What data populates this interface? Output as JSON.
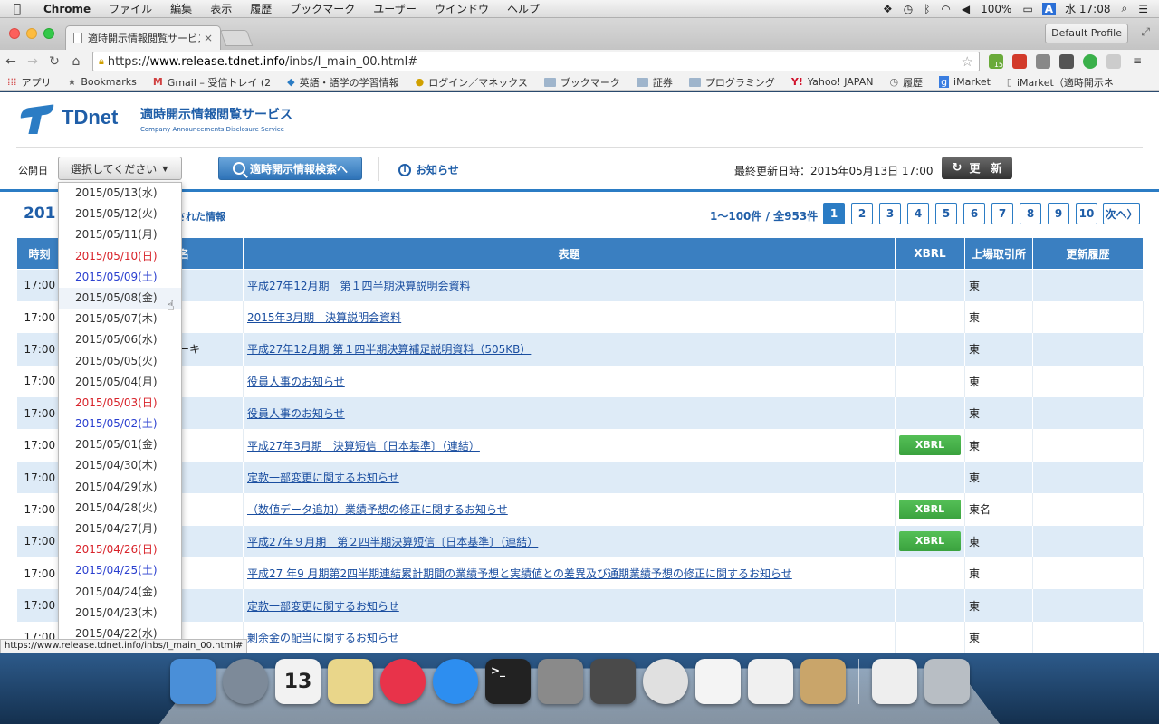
{
  "menubar": {
    "app": "Chrome",
    "items": [
      "ファイル",
      "編集",
      "表示",
      "履歴",
      "ブックマーク",
      "ユーザー",
      "ウインドウ",
      "ヘルプ"
    ],
    "battery": "100%",
    "input_source": "A",
    "clock": "水 17:08"
  },
  "browser": {
    "tab_title": "適時開示情報閲覧サービス –",
    "profile": "Default Profile",
    "url_scheme": "https://",
    "url_host": "www.release.tdnet.info",
    "url_path": "/inbs/I_main_00.html#",
    "ext_badge": "15",
    "bookmarks": [
      "アプリ",
      "Bookmarks",
      "Gmail – 受信トレイ (2",
      "英語・語学の学習情報",
      "ログイン／マネックス",
      "ブックマーク",
      "証券",
      "プログラミング",
      "Yahoo! JAPAN",
      "履歴",
      "iMarket",
      "iMarket（適時開示ネ"
    ],
    "status_url": "https://www.release.tdnet.info/inbs/I_main_00.html#"
  },
  "site": {
    "logo": "TDnet",
    "title_jp": "適時開示情報閲覧サービス",
    "title_en": "Company Announcements Disclosure Service"
  },
  "controls": {
    "date_label": "公開日",
    "select_label": "選択してください",
    "search_label": "適時開示情報検索へ",
    "notice_label": "お知らせ",
    "updated_label": "最終更新日時：2015年05月13日 17:00",
    "refresh_label": "更　新"
  },
  "listhead": {
    "date_title": "201",
    "subtitle": "示された情報",
    "count": "1〜100件 / 全953件",
    "pages": [
      "1",
      "2",
      "3",
      "4",
      "5",
      "6",
      "7",
      "8",
      "9",
      "10"
    ],
    "next": "次へ"
  },
  "table": {
    "headers": {
      "time": "時刻",
      "name": "名",
      "title": "表題",
      "xbrl": "XBRL",
      "exchange": "上場取引所",
      "history": "更新履歴"
    },
    "rows": [
      {
        "time": "17:00",
        "name": "",
        "title": "平成27年12月期　第１四半期決算説明会資料",
        "xbrl": "",
        "exchange": "東"
      },
      {
        "time": "17:00",
        "name": "",
        "title": "2015年3月期　決算説明会資料",
        "xbrl": "",
        "exchange": "東"
      },
      {
        "time": "17:00",
        "name": "ーキ",
        "title": "平成27年12月期 第１四半期決算補足説明資料（505KB）",
        "xbrl": "",
        "exchange": "東"
      },
      {
        "time": "17:00",
        "name": "",
        "title": "役員人事のお知らせ",
        "xbrl": "",
        "exchange": "東"
      },
      {
        "time": "17:00",
        "name": "",
        "title": "役員人事のお知らせ",
        "xbrl": "",
        "exchange": "東"
      },
      {
        "time": "17:00",
        "name": "",
        "title": "平成27年3月期　決算短信〔日本基準〕（連結）",
        "xbrl": "XBRL",
        "exchange": "東"
      },
      {
        "time": "17:00",
        "name": "",
        "title": "定款一部変更に関するお知らせ",
        "xbrl": "",
        "exchange": "東"
      },
      {
        "time": "17:00",
        "name": "",
        "title": "（数値データ追加）業績予想の修正に関するお知らせ",
        "xbrl": "XBRL",
        "exchange": "東名"
      },
      {
        "time": "17:00",
        "name": "",
        "title": "平成27年９月期　第２四半期決算短信〔日本基準〕（連結）",
        "xbrl": "XBRL",
        "exchange": "東"
      },
      {
        "time": "17:00",
        "name": "",
        "title": "平成27 年9 月期第2四半期連結累計期間の業績予想と実績値との差異及び通期業績予想の修正に関するお知らせ",
        "xbrl": "",
        "exchange": "東"
      },
      {
        "time": "17:00",
        "name": "",
        "title": "定款一部変更に関するお知らせ",
        "xbrl": "",
        "exchange": "東"
      },
      {
        "time": "17:00",
        "name": "",
        "title": "剰余金の配当に関するお知らせ",
        "xbrl": "",
        "exchange": "東"
      }
    ]
  },
  "dropdown": {
    "options": [
      {
        "label": "2015/05/13(水)",
        "kind": "weekday"
      },
      {
        "label": "2015/05/12(火)",
        "kind": "weekday"
      },
      {
        "label": "2015/05/11(月)",
        "kind": "weekday"
      },
      {
        "label": "2015/05/10(日)",
        "kind": "sunday"
      },
      {
        "label": "2015/05/09(土)",
        "kind": "saturday"
      },
      {
        "label": "2015/05/08(金)",
        "kind": "hover"
      },
      {
        "label": "2015/05/07(木)",
        "kind": "weekday"
      },
      {
        "label": "2015/05/06(水)",
        "kind": "weekday"
      },
      {
        "label": "2015/05/05(火)",
        "kind": "weekday"
      },
      {
        "label": "2015/05/04(月)",
        "kind": "weekday"
      },
      {
        "label": "2015/05/03(日)",
        "kind": "sunday"
      },
      {
        "label": "2015/05/02(土)",
        "kind": "saturday"
      },
      {
        "label": "2015/05/01(金)",
        "kind": "weekday"
      },
      {
        "label": "2015/04/30(木)",
        "kind": "weekday"
      },
      {
        "label": "2015/04/29(水)",
        "kind": "weekday"
      },
      {
        "label": "2015/04/28(火)",
        "kind": "weekday"
      },
      {
        "label": "2015/04/27(月)",
        "kind": "weekday"
      },
      {
        "label": "2015/04/26(日)",
        "kind": "sunday"
      },
      {
        "label": "2015/04/25(土)",
        "kind": "saturday"
      },
      {
        "label": "2015/04/24(金)",
        "kind": "weekday"
      },
      {
        "label": "2015/04/23(木)",
        "kind": "weekday"
      },
      {
        "label": "2015/04/22(水)",
        "kind": "weekday"
      }
    ]
  },
  "dock": {
    "calendar_day": "13",
    "terminal_prompt": ">_",
    "apps": [
      {
        "name": "finder",
        "color": "#4a8fd8"
      },
      {
        "name": "launchpad",
        "color": "#7d8a99"
      },
      {
        "name": "calendar",
        "color": "#f2f2f2"
      },
      {
        "name": "notes",
        "color": "#e9d68a"
      },
      {
        "name": "itunes",
        "color": "#e8334a"
      },
      {
        "name": "app-store",
        "color": "#2d8ef0"
      },
      {
        "name": "terminal",
        "color": "#222222"
      },
      {
        "name": "system-preferences",
        "color": "#8a8a8a"
      },
      {
        "name": "sublime-text",
        "color": "#4a4a4a"
      },
      {
        "name": "chrome",
        "color": "#e0e0e0"
      },
      {
        "name": "grid-app",
        "color": "#f4f4f4"
      },
      {
        "name": "textedit",
        "color": "#f0f0f0"
      },
      {
        "name": "preview",
        "color": "#c9a56a"
      },
      {
        "name": "chrome-download",
        "color": "#eeeeee"
      },
      {
        "name": "trash",
        "color": "#b8bec4"
      }
    ]
  }
}
